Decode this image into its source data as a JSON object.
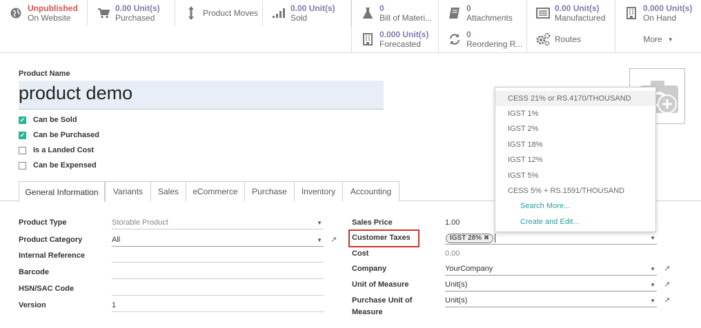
{
  "smart_buttons": {
    "website": {
      "value": "Unpublished",
      "label": "On Website",
      "icon": "globe-icon"
    },
    "purchased": {
      "value": "0.00 Unit(s)",
      "label": "Purchased",
      "icon": "cart-icon"
    },
    "moves": {
      "label": "Product Moves",
      "icon": "updown-arrow-icon"
    },
    "sold": {
      "value": "0.00 Unit(s)",
      "label": "Sold",
      "icon": "bar-chart-icon"
    },
    "bom": {
      "value": "0",
      "label": "Bill of Materi...",
      "icon": "flask-icon"
    },
    "attachments": {
      "value": "0",
      "label": "Attachments",
      "icon": "book-icon"
    },
    "manufactured": {
      "value": "0.00 Unit(s)",
      "label": "Manufactured",
      "icon": "list-icon"
    },
    "on_hand": {
      "value": "0.000 Unit(s)",
      "label": "On Hand",
      "icon": "building-icon"
    },
    "forecasted": {
      "value": "0.000 Unit(s)",
      "label": "Forecasted",
      "icon": "building-icon"
    },
    "reordering": {
      "value": "0",
      "label": "Reordering R...",
      "icon": "refresh-icon"
    },
    "routes": {
      "label": "Routes",
      "icon": "cogs-icon"
    },
    "more": {
      "label": "More"
    }
  },
  "product": {
    "name_label": "Product Name",
    "name": "product demo",
    "checkboxes": [
      {
        "label": "Can be Sold",
        "checked": true
      },
      {
        "label": "Can be Purchased",
        "checked": true
      },
      {
        "label": "Is a Landed Cost",
        "checked": false
      },
      {
        "label": "Can be Expensed",
        "checked": false
      }
    ]
  },
  "tabs": [
    "General Information",
    "Variants",
    "Sales",
    "eCommerce",
    "Purchase",
    "Inventory",
    "Accounting"
  ],
  "left_fields": {
    "product_type": {
      "label": "Product Type",
      "value": "Storable Product"
    },
    "product_category": {
      "label": "Product Category",
      "value": "All"
    },
    "internal_reference": {
      "label": "Internal Reference",
      "value": ""
    },
    "barcode": {
      "label": "Barcode",
      "value": ""
    },
    "hsn": {
      "label": "HSN/SAC Code",
      "value": ""
    },
    "version": {
      "label": "Version",
      "value": "1"
    }
  },
  "right_fields": {
    "sales_price": {
      "label": "Sales Price",
      "value": "1.00"
    },
    "customer_taxes": {
      "label": "Customer Taxes",
      "tag": "IGST 28%"
    },
    "cost": {
      "label": "Cost",
      "value": "0.00"
    },
    "company": {
      "label": "Company",
      "value": "YourCompany"
    },
    "uom": {
      "label": "Unit of Measure",
      "value": "Unit(s)"
    },
    "purchase_uom": {
      "label_line1": "Purchase Unit of",
      "label_line2": "Measure",
      "value": "Unit(s)"
    }
  },
  "dropdown": {
    "items": [
      "CESS 21% or RS.4170/THOUSAND",
      "IGST 1%",
      "IGST 2%",
      "IGST 18%",
      "IGST 12%",
      "IGST 5%",
      "CESS 5% + RS.1591/THOUSAND"
    ],
    "search_more": "Search More...",
    "create_edit": "Create and Edit..."
  },
  "colors": {
    "accent": "#7c7bad",
    "unpublished": "#d9534f",
    "checkbox": "#21b799",
    "link": "#2a9d9d",
    "highlight_box": "#d32f2f"
  }
}
